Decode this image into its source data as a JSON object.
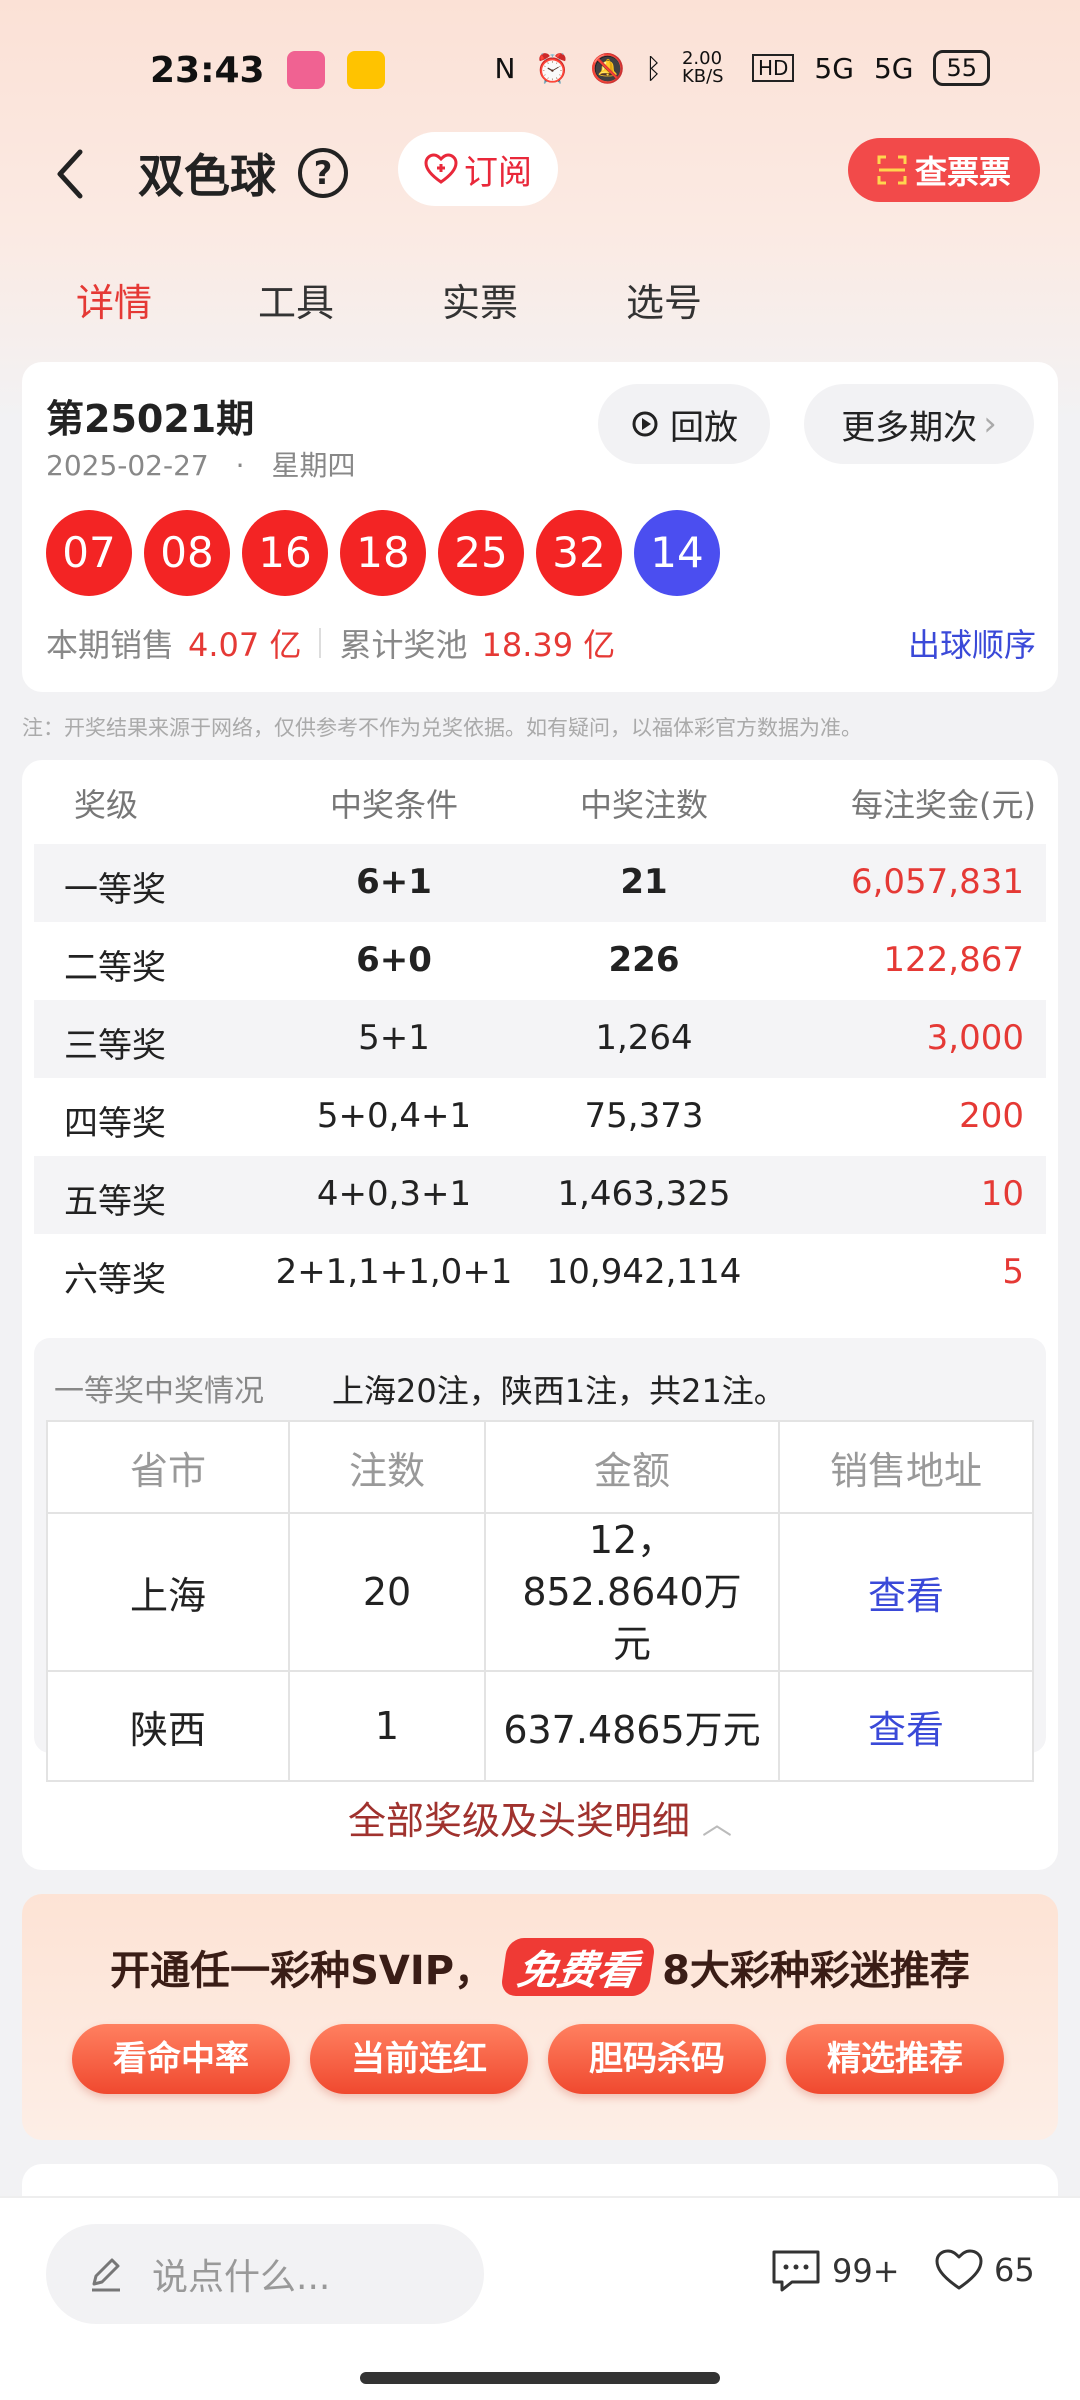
{
  "status_bar": {
    "time": "23:43",
    "net_speed": "2.00 KB/S",
    "signal1": "5G",
    "signal2": "5G",
    "battery": "55"
  },
  "header": {
    "title": "双色球",
    "help_symbol": "?",
    "subscribe_label": "订阅",
    "check_ticket_label": "查票票"
  },
  "tabs": [
    {
      "label": "详情",
      "active": true
    },
    {
      "label": "工具",
      "active": false
    },
    {
      "label": "实票",
      "active": false
    },
    {
      "label": "选号",
      "active": false
    }
  ],
  "draw": {
    "issue": "第25021期",
    "date": "2025-02-27",
    "separator": "·",
    "weekday": "星期四",
    "replay_label": "回放",
    "more_label": "更多期次",
    "red_balls": [
      "07",
      "08",
      "16",
      "18",
      "25",
      "32"
    ],
    "blue_ball": "14",
    "sales_label": "本期销售",
    "sales_value": "4.07 亿",
    "pool_label": "累计奖池",
    "pool_value": "18.39 亿",
    "order_link": "出球顺序"
  },
  "note": "注：开奖结果来源于网络，仅供参考不作为兑奖依据。如有疑问，以福体彩官方数据为准。",
  "prize_table": {
    "headers": [
      "奖级",
      "中奖条件",
      "中奖注数",
      "每注奖金(元)"
    ],
    "rows": [
      {
        "level": "一等奖",
        "condition": "6+1",
        "count": "21",
        "amount": "6,057,831"
      },
      {
        "level": "二等奖",
        "condition": "6+0",
        "count": "226",
        "amount": "122,867"
      },
      {
        "level": "三等奖",
        "condition": "5+1",
        "count": "1,264",
        "amount": "3,000"
      },
      {
        "level": "四等奖",
        "condition": "5+0,4+1",
        "count": "75,373",
        "amount": "200"
      },
      {
        "level": "五等奖",
        "condition": "4+0,3+1",
        "count": "1,463,325",
        "amount": "10"
      },
      {
        "level": "六等奖",
        "condition": "2+1,1+1,0+1",
        "count": "10,942,114",
        "amount": "5"
      }
    ]
  },
  "first_prize": {
    "label": "一等奖中奖情况",
    "summary": "上海20注，陕西1注，共21注。",
    "headers": [
      "省市",
      "注数",
      "金额",
      "销售地址"
    ],
    "rows": [
      {
        "region": "上海",
        "count": "20",
        "amount": "12，852.8640万元",
        "address": "查看"
      },
      {
        "region": "陕西",
        "count": "1",
        "amount": "637.4865万元",
        "address": "查看"
      }
    ]
  },
  "expand_label": "全部奖级及头奖明细",
  "promo": {
    "text_before": "开通任一彩种SVIP，",
    "free_badge": "免费看",
    "text_after": "8大彩种彩迷推荐",
    "pills": [
      "看命中率",
      "当前连红",
      "胆码杀码",
      "精选推荐"
    ]
  },
  "bottom_bar": {
    "comment_placeholder": "说点什么...",
    "comment_count": "99+",
    "like_count": "65"
  },
  "colors": {
    "accent_red": "#e53935",
    "blue_ball": "#4b4ef0",
    "link_blue": "#3a49d8"
  }
}
